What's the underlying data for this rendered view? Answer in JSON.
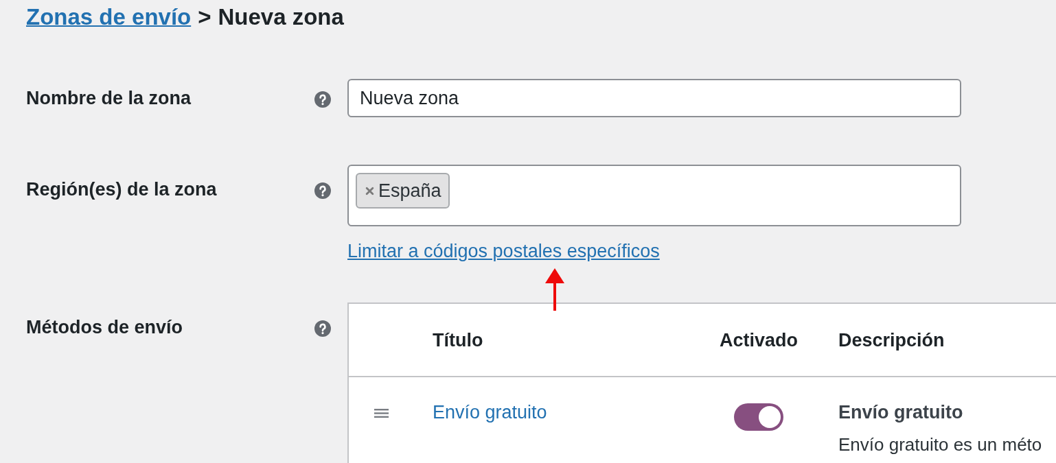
{
  "breadcrumb": {
    "link": "Zonas de envío",
    "separator": ">",
    "current": "Nueva zona"
  },
  "fields": [
    {
      "kind": "text",
      "label": "Nombre de la zona",
      "value": "Nueva zona"
    },
    {
      "kind": "tags",
      "label": "Región(es) de la zona",
      "tags": [
        "España"
      ],
      "link": "Limitar a códigos postales específicos"
    },
    {
      "kind": "table",
      "label": "Métodos de envío",
      "columns": [
        "Título",
        "Activado",
        "Descripción"
      ],
      "rows": [
        {
          "title": "Envío gratuito",
          "enabled": true,
          "description_title": "Envío gratuito",
          "description": "Envío gratuito es un méto"
        }
      ]
    }
  ],
  "annotation": {
    "kind": "arrow"
  }
}
